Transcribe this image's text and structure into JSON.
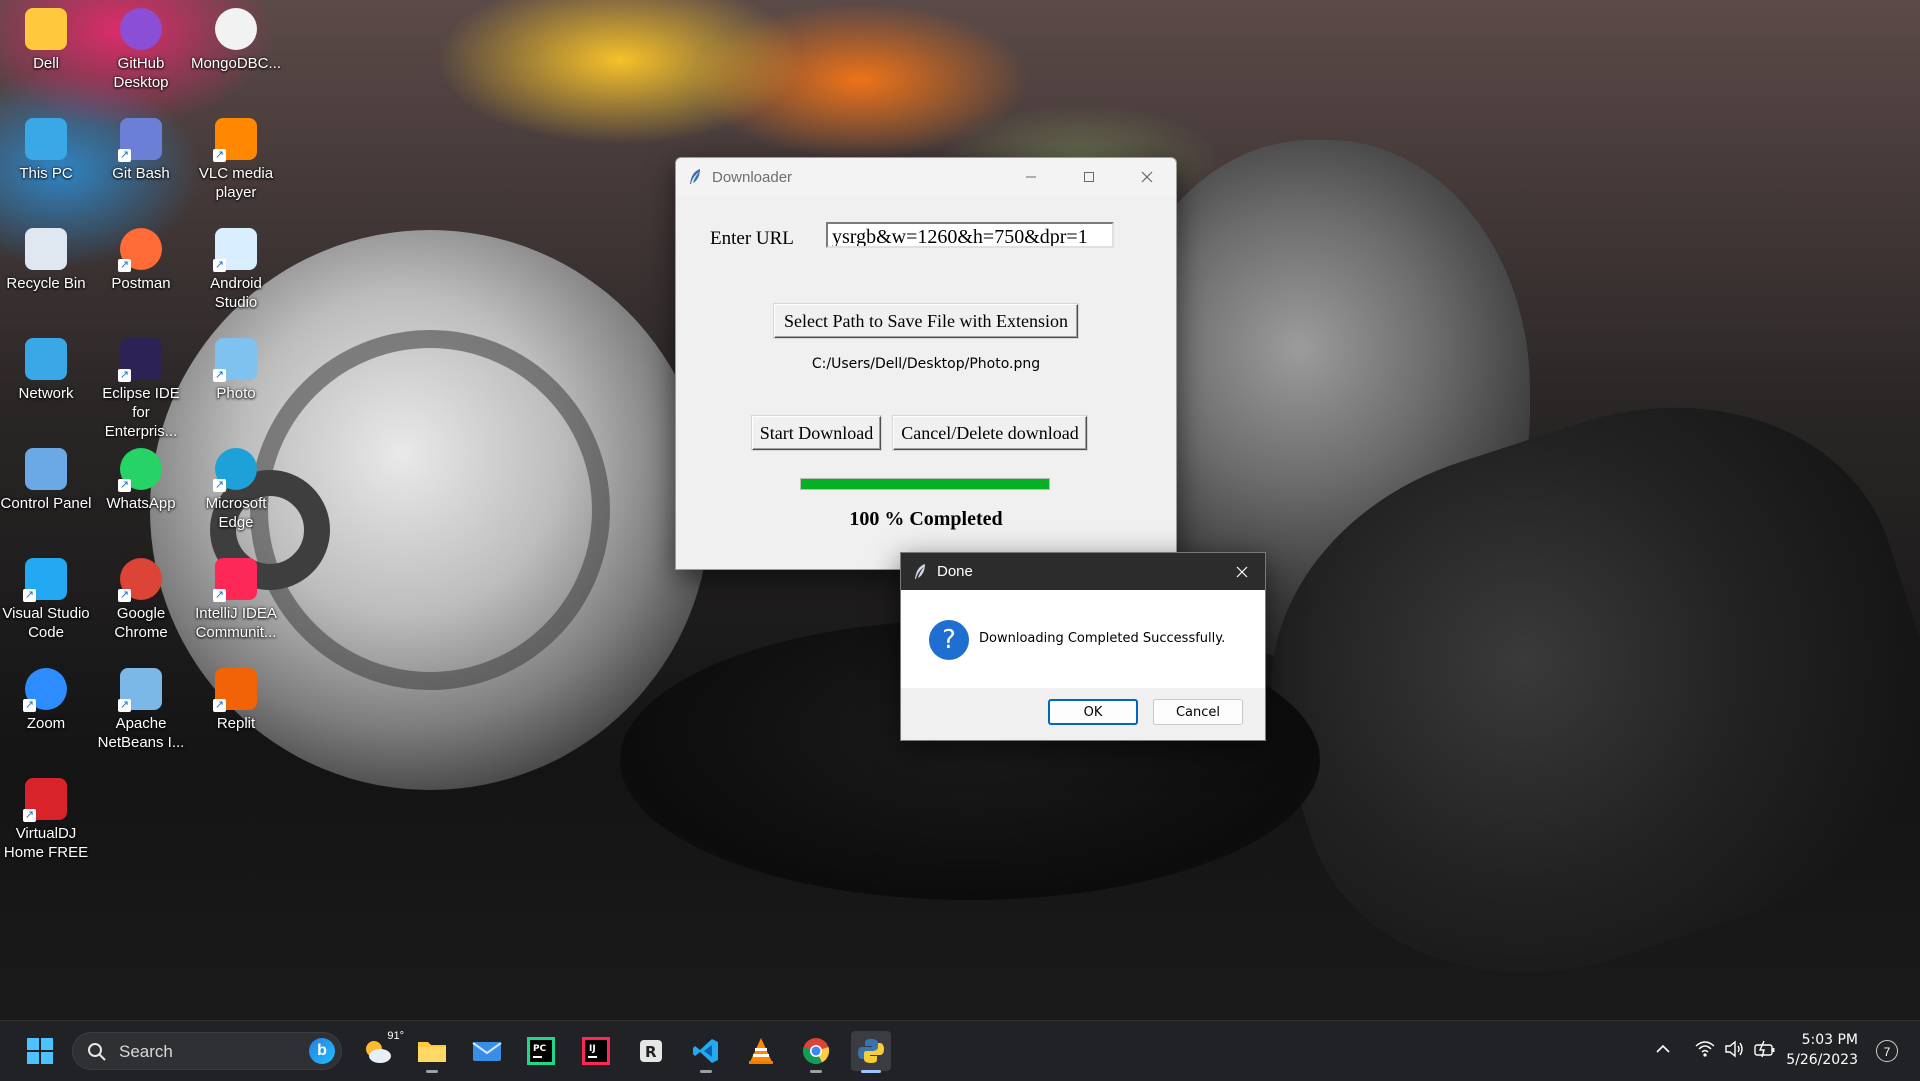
{
  "desktop": {
    "icons": [
      {
        "label": "Dell",
        "icon": "folder-icon"
      },
      {
        "label": "GitHub Desktop",
        "icon": "github-desktop-icon"
      },
      {
        "label": "MongoDBC...",
        "icon": "mongodb-compass-icon"
      },
      {
        "label": "This PC",
        "icon": "this-pc-icon"
      },
      {
        "label": "Git Bash",
        "icon": "git-bash-icon"
      },
      {
        "label": "VLC media player",
        "icon": "vlc-icon"
      },
      {
        "label": "Recycle Bin",
        "icon": "recycle-bin-icon"
      },
      {
        "label": "Postman",
        "icon": "postman-icon"
      },
      {
        "label": "Android Studio",
        "icon": "android-studio-icon"
      },
      {
        "label": "Network",
        "icon": "network-icon"
      },
      {
        "label": "Eclipse IDE for Enterpris...",
        "icon": "eclipse-icon"
      },
      {
        "label": "Photo",
        "icon": "photo-icon"
      },
      {
        "label": "Control Panel",
        "icon": "control-panel-icon"
      },
      {
        "label": "WhatsApp",
        "icon": "whatsapp-icon"
      },
      {
        "label": "Microsoft Edge",
        "icon": "edge-icon"
      },
      {
        "label": "Visual Studio Code",
        "icon": "vscode-icon"
      },
      {
        "label": "Google Chrome",
        "icon": "chrome-icon"
      },
      {
        "label": "IntelliJ IDEA Communit...",
        "icon": "intellij-icon"
      },
      {
        "label": "Zoom",
        "icon": "zoom-icon"
      },
      {
        "label": "Apache NetBeans I...",
        "icon": "netbeans-icon"
      },
      {
        "label": "Replit",
        "icon": "replit-icon"
      },
      {
        "label": "VirtualDJ Home FREE",
        "icon": "virtualdj-icon"
      }
    ]
  },
  "downloader": {
    "title": "Downloader",
    "url_label": "Enter URL",
    "url_value": "ysrgb&w=1260&h=750&dpr=1",
    "select_path_button": "Select Path to Save File with Extension",
    "save_path": "C:/Users/Dell/Desktop/Photo.png",
    "start_button": "Start Download",
    "cancel_button": "Cancel/Delete download",
    "progress_fraction": 1.0,
    "status": "100 % Completed"
  },
  "dialog": {
    "title": "Done",
    "message": "Downloading Completed Successfully.",
    "ok_label": "OK",
    "cancel_label": "Cancel",
    "icon": "question-icon"
  },
  "taskbar": {
    "search_label": "Search",
    "weather_temp": "91°",
    "apps": [
      "weather",
      "file-explorer",
      "mail",
      "pycharm",
      "intellij",
      "app-r",
      "vscode",
      "vlc",
      "chrome",
      "python"
    ],
    "time": "5:03 PM",
    "date": "5/26/2023",
    "notification_count": "7"
  },
  "colors": {
    "progress": "#06b025",
    "dialog_accent": "#0067c0",
    "taskbar": "#202226"
  }
}
